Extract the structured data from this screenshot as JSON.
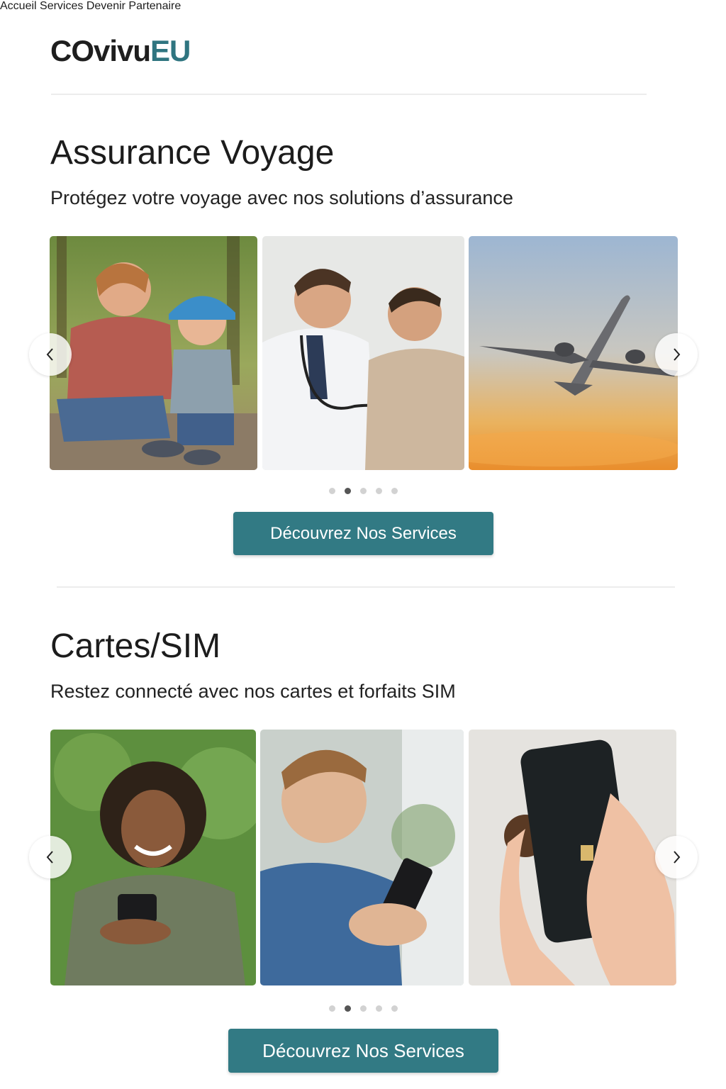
{
  "header": {
    "logo_dark": "COvivu",
    "logo_accent": "EU",
    "nav": [
      "Accueil",
      "Services",
      "Devenir Partenaire"
    ]
  },
  "sections": [
    {
      "title": "Assurance Voyage",
      "subtitle": "Protégez votre voyage avec nos solutions d’assurance",
      "slides": [
        "Parent soignant un enfant blessé",
        "Médecin examinant un patient",
        "Avion au coucher du soleil"
      ],
      "active_dot": 2,
      "dot_count": 5,
      "cta": "Découvrez Nos Services"
    },
    {
      "title": "Cartes/SIM",
      "subtitle": "Restez connecté avec nos cartes et forfaits SIM",
      "slides": [
        "Femme souriante utilisant un smartphone",
        "Homme utilisant un smartphone",
        "Insertion d’une carte SIM"
      ],
      "active_dot": 2,
      "dot_count": 5,
      "cta": "Découvrez Nos Services"
    }
  ],
  "icons": {
    "prev": "chevron-left-icon",
    "next": "chevron-right-icon"
  },
  "colors": {
    "accent": "#327a84",
    "logo_accent": "#2f7580",
    "dot_active": "#555555",
    "dot_inactive": "#d2d2d2"
  }
}
